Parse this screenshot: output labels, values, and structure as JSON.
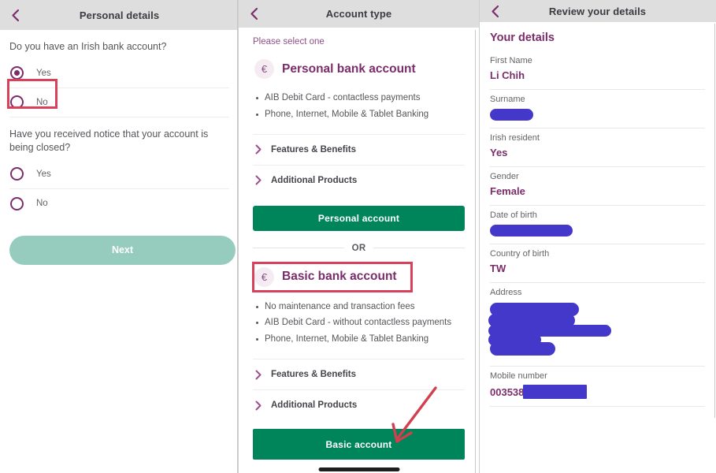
{
  "panels": {
    "personal_details": {
      "header_title": "Personal details",
      "back_icon": "chevron-left-icon",
      "question_1": "Do you have an Irish bank account?",
      "q1_options": [
        {
          "label": "Yes",
          "selected": true
        },
        {
          "label": "No",
          "selected": false
        }
      ],
      "question_2": "Have you received notice that your account is being closed?",
      "q2_options": [
        {
          "label": "Yes",
          "selected": false
        },
        {
          "label": "No",
          "selected": false
        }
      ],
      "next_button": "Next"
    },
    "account_type": {
      "header_title": "Account type",
      "back_icon": "chevron-left-icon",
      "select_prompt": "Please select one",
      "options": [
        {
          "icon": "euro-icon",
          "icon_glyph": "€",
          "title": "Personal bank account",
          "features": [
            "AIB Debit Card - contactless payments",
            "Phone, Internet, Mobile & Tablet Banking"
          ],
          "expanders": [
            "Features & Benefits",
            "Additional Products"
          ],
          "cta": "Personal account"
        },
        {
          "icon": "euro-icon",
          "icon_glyph": "€",
          "title": "Basic bank account",
          "features": [
            "No maintenance and transaction fees",
            "AIB Debit Card - without contactless payments",
            "Phone, Internet, Mobile & Tablet Banking"
          ],
          "expanders": [
            "Features & Benefits",
            "Additional Products"
          ],
          "cta": "Basic account"
        }
      ],
      "divider_label": "OR"
    },
    "review_details": {
      "header_title": "Review your details",
      "back_icon": "chevron-left-icon",
      "section_title": "Your details",
      "fields": [
        {
          "label": "First Name",
          "value": "Li Chih",
          "redacted": false
        },
        {
          "label": "Surname",
          "value": "",
          "redacted": true
        },
        {
          "label": "Irish resident",
          "value": "Yes",
          "redacted": false
        },
        {
          "label": "Gender",
          "value": "Female",
          "redacted": false
        },
        {
          "label": "Date of birth",
          "value": "",
          "redacted": true
        },
        {
          "label": "Country of birth",
          "value": "TW",
          "redacted": false
        },
        {
          "label": "Address",
          "value": "",
          "redacted": true
        },
        {
          "label": "Mobile number",
          "value": "003538",
          "redacted": true
        }
      ]
    }
  },
  "annotations": {
    "highlight_no_option": "No",
    "highlight_basic_account": "Basic bank account",
    "arrow_target": "Basic account",
    "color": "#d9415a"
  },
  "colors": {
    "brand_purple": "#7b2d6b",
    "brand_green": "#00855a",
    "muted_green": "#96ccbd",
    "header_grey": "#dedede",
    "redaction_blue": "#4338ca",
    "annotation_red": "#d9415a"
  }
}
